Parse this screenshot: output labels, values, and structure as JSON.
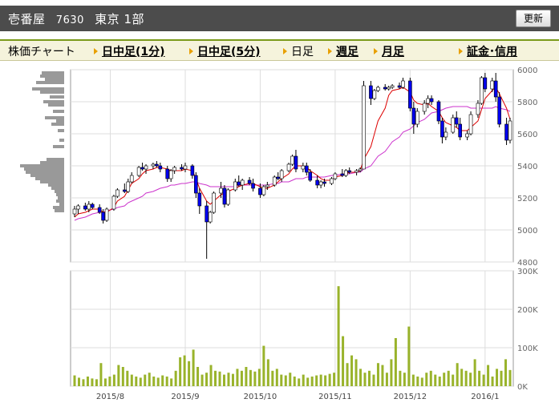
{
  "header": {
    "company": "壱番屋",
    "code": "7630",
    "market": "東京 1部",
    "update_label": "更新"
  },
  "menu": {
    "chart_label": "株価チャート",
    "intraday_1": "日中足(1分)",
    "intraday_5": "日中足(5分)",
    "daily": "日足",
    "weekly": "週足",
    "monthly": "月足",
    "margin": "証金･信用"
  },
  "colors": {
    "up_candle": "#ffffff",
    "down_candle": "#0000ee",
    "ma_short": "#dd0000",
    "ma_long": "#cc33cc",
    "volume": "#99b32b",
    "profile": "#999999",
    "menu_accent": "#7a9a1a"
  },
  "chart_data": {
    "type": "candlestick",
    "price_axis": {
      "ticks": [
        "6000",
        "5800",
        "5600",
        "5400",
        "5200",
        "5000",
        "4800"
      ],
      "ylim": [
        4800,
        6000
      ]
    },
    "volume_axis": {
      "ticks": [
        "300K",
        "200K",
        "100K",
        "0K"
      ],
      "ylim": [
        0,
        300000
      ]
    },
    "x_labels": [
      "2015/8",
      "2015/9",
      "2015/10",
      "2015/11",
      "2015/12",
      "2016/1"
    ],
    "candles": [
      [
        5100,
        5150,
        5080,
        5130
      ],
      [
        5130,
        5160,
        5100,
        5150
      ],
      [
        5150,
        5170,
        5120,
        5130
      ],
      [
        5130,
        5180,
        5110,
        5160
      ],
      [
        5160,
        5170,
        5130,
        5140
      ],
      [
        5140,
        5160,
        5100,
        5110
      ],
      [
        5110,
        5130,
        5040,
        5060
      ],
      [
        5060,
        5140,
        5050,
        5130
      ],
      [
        5130,
        5220,
        5120,
        5210
      ],
      [
        5210,
        5260,
        5200,
        5250
      ],
      [
        5250,
        5290,
        5230,
        5240
      ],
      [
        5240,
        5320,
        5230,
        5300
      ],
      [
        5300,
        5360,
        5290,
        5340
      ],
      [
        5340,
        5400,
        5330,
        5390
      ],
      [
        5390,
        5420,
        5370,
        5380
      ],
      [
        5380,
        5410,
        5350,
        5400
      ],
      [
        5400,
        5420,
        5380,
        5410
      ],
      [
        5410,
        5430,
        5390,
        5400
      ],
      [
        5400,
        5420,
        5360,
        5380
      ],
      [
        5380,
        5400,
        5300,
        5320
      ],
      [
        5320,
        5380,
        5300,
        5370
      ],
      [
        5370,
        5400,
        5350,
        5390
      ],
      [
        5390,
        5410,
        5370,
        5380
      ],
      [
        5380,
        5420,
        5360,
        5400
      ],
      [
        5400,
        5410,
        5320,
        5340
      ],
      [
        5340,
        5360,
        5200,
        5230
      ],
      [
        5230,
        5260,
        5100,
        5150
      ],
      [
        5150,
        5180,
        4820,
        5050
      ],
      [
        5050,
        5120,
        5040,
        5110
      ],
      [
        5110,
        5240,
        5100,
        5230
      ],
      [
        5230,
        5300,
        5200,
        5260
      ],
      [
        5260,
        5280,
        5140,
        5160
      ],
      [
        5160,
        5260,
        5150,
        5250
      ],
      [
        5250,
        5320,
        5240,
        5300
      ],
      [
        5300,
        5340,
        5270,
        5280
      ],
      [
        5280,
        5320,
        5250,
        5310
      ],
      [
        5310,
        5330,
        5280,
        5290
      ],
      [
        5290,
        5320,
        5240,
        5260
      ],
      [
        5260,
        5290,
        5200,
        5220
      ],
      [
        5220,
        5280,
        5210,
        5270
      ],
      [
        5270,
        5300,
        5250,
        5280
      ],
      [
        5280,
        5340,
        5270,
        5330
      ],
      [
        5330,
        5360,
        5310,
        5320
      ],
      [
        5320,
        5380,
        5300,
        5370
      ],
      [
        5370,
        5420,
        5360,
        5410
      ],
      [
        5410,
        5470,
        5400,
        5460
      ],
      [
        5460,
        5500,
        5360,
        5380
      ],
      [
        5380,
        5420,
        5360,
        5400
      ],
      [
        5400,
        5420,
        5340,
        5360
      ],
      [
        5360,
        5380,
        5300,
        5310
      ],
      [
        5310,
        5340,
        5260,
        5280
      ],
      [
        5280,
        5310,
        5260,
        5300
      ],
      [
        5300,
        5320,
        5270,
        5290
      ],
      [
        5290,
        5330,
        5280,
        5320
      ],
      [
        5320,
        5360,
        5310,
        5350
      ],
      [
        5350,
        5380,
        5330,
        5340
      ],
      [
        5340,
        5380,
        5330,
        5370
      ],
      [
        5370,
        5390,
        5350,
        5360
      ],
      [
        5360,
        5380,
        5340,
        5370
      ],
      [
        5370,
        5390,
        5360,
        5380
      ],
      [
        5380,
        5930,
        5380,
        5900
      ],
      [
        5900,
        5930,
        5780,
        5820
      ],
      [
        5820,
        5880,
        5810,
        5870
      ],
      [
        5870,
        5900,
        5860,
        5890
      ],
      [
        5890,
        5910,
        5870,
        5880
      ],
      [
        5880,
        5900,
        5870,
        5890
      ],
      [
        5890,
        5910,
        5880,
        5900
      ],
      [
        5900,
        5920,
        5880,
        5890
      ],
      [
        5890,
        5950,
        5880,
        5930
      ],
      [
        5930,
        5950,
        5740,
        5760
      ],
      [
        5760,
        5800,
        5600,
        5660
      ],
      [
        5660,
        5760,
        5640,
        5740
      ],
      [
        5740,
        5810,
        5720,
        5790
      ],
      [
        5790,
        5840,
        5760,
        5820
      ],
      [
        5820,
        5840,
        5780,
        5800
      ],
      [
        5800,
        5810,
        5660,
        5680
      ],
      [
        5680,
        5700,
        5540,
        5580
      ],
      [
        5580,
        5640,
        5560,
        5610
      ],
      [
        5610,
        5720,
        5600,
        5700
      ],
      [
        5700,
        5740,
        5640,
        5660
      ],
      [
        5660,
        5700,
        5560,
        5580
      ],
      [
        5580,
        5620,
        5560,
        5600
      ],
      [
        5600,
        5740,
        5590,
        5720
      ],
      [
        5720,
        5810,
        5700,
        5790
      ],
      [
        5790,
        5960,
        5780,
        5950
      ],
      [
        5950,
        5980,
        5860,
        5880
      ],
      [
        5880,
        5950,
        5860,
        5930
      ],
      [
        5930,
        5980,
        5800,
        5830
      ],
      [
        5830,
        5860,
        5640,
        5660
      ],
      [
        5660,
        5700,
        5530,
        5560
      ],
      [
        5560,
        5700,
        5540,
        5680
      ]
    ],
    "ma_short": [
      5080,
      5100,
      5110,
      5120,
      5130,
      5130,
      5110,
      5110,
      5140,
      5180,
      5210,
      5250,
      5290,
      5320,
      5350,
      5370,
      5380,
      5390,
      5390,
      5380,
      5370,
      5370,
      5370,
      5380,
      5370,
      5320,
      5260,
      5180,
      5160,
      5180,
      5220,
      5230,
      5240,
      5260,
      5270,
      5280,
      5290,
      5290,
      5270,
      5260,
      5260,
      5280,
      5300,
      5320,
      5350,
      5380,
      5400,
      5400,
      5390,
      5370,
      5340,
      5320,
      5310,
      5310,
      5330,
      5340,
      5350,
      5360,
      5360,
      5370,
      5440,
      5520,
      5600,
      5680,
      5760,
      5840,
      5870,
      5880,
      5890,
      5860,
      5810,
      5790,
      5780,
      5790,
      5770,
      5740,
      5700,
      5670,
      5650,
      5640,
      5620,
      5620,
      5640,
      5680,
      5750,
      5820,
      5870,
      5890,
      5850,
      5760,
      5690
    ],
    "ma_long": [
      5060,
      5070,
      5080,
      5090,
      5100,
      5110,
      5110,
      5120,
      5130,
      5140,
      5150,
      5170,
      5180,
      5200,
      5210,
      5230,
      5240,
      5250,
      5260,
      5270,
      5280,
      5280,
      5290,
      5290,
      5300,
      5300,
      5290,
      5280,
      5270,
      5270,
      5270,
      5270,
      5270,
      5270,
      5280,
      5280,
      5280,
      5280,
      5280,
      5280,
      5280,
      5290,
      5290,
      5300,
      5300,
      5310,
      5320,
      5320,
      5330,
      5330,
      5330,
      5330,
      5330,
      5340,
      5340,
      5350,
      5350,
      5350,
      5360,
      5360,
      5380,
      5400,
      5430,
      5460,
      5490,
      5520,
      5550,
      5580,
      5610,
      5630,
      5650,
      5670,
      5690,
      5710,
      5730,
      5740,
      5750,
      5760,
      5770,
      5770,
      5770,
      5770,
      5760,
      5760,
      5760,
      5760,
      5760,
      5770,
      5760,
      5750,
      5740
    ],
    "volumes": [
      28000,
      22000,
      18000,
      25000,
      20000,
      18000,
      60000,
      20000,
      25000,
      30000,
      55000,
      50000,
      40000,
      30000,
      25000,
      22000,
      30000,
      35000,
      25000,
      22000,
      28000,
      25000,
      20000,
      40000,
      75000,
      80000,
      65000,
      95000,
      50000,
      30000,
      35000,
      55000,
      40000,
      38000,
      30000,
      35000,
      32000,
      45000,
      40000,
      50000,
      42000,
      38000,
      45000,
      105000,
      70000,
      40000,
      45000,
      30000,
      28000,
      35000,
      25000,
      20000,
      30000,
      22000,
      25000,
      28000,
      30000,
      28000,
      32000,
      35000,
      260000,
      130000,
      60000,
      80000,
      70000,
      45000,
      35000,
      40000,
      30000,
      60000,
      55000,
      35000,
      70000,
      125000,
      40000,
      35000,
      155000,
      30000,
      25000,
      22000,
      35000,
      40000,
      30000,
      25000,
      35000,
      40000,
      30000,
      60000,
      45000,
      40000,
      35000,
      70000,
      40000,
      30000,
      55000,
      25000,
      45000,
      40000,
      70000,
      42000
    ],
    "profile": [
      5980,
      5960,
      5940,
      5920,
      5880,
      5860,
      5830,
      5800,
      5780,
      5740,
      5700,
      5680,
      5660,
      5620,
      5560,
      5520,
      5440,
      5420,
      5400,
      5380,
      5360,
      5340,
      5320,
      5300,
      5280,
      5260,
      5240,
      5220,
      5200,
      5180,
      5160,
      5140,
      5120
    ]
  }
}
